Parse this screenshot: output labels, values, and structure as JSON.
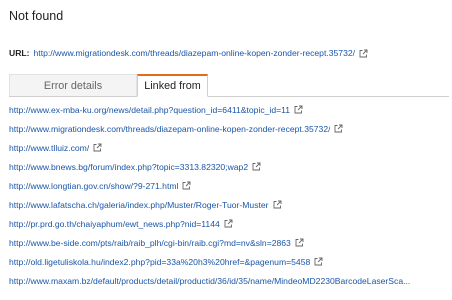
{
  "status": {
    "title": "Not found"
  },
  "url_row": {
    "label": "URL:",
    "url": "http://www.migrationdesk.com/threads/diazepam-online-kopen-zonder-recept.35732/"
  },
  "tabs": [
    {
      "label": "Error details",
      "active": false
    },
    {
      "label": "Linked from",
      "active": true
    }
  ],
  "linked_from": [
    "http://www.ex-mba-ku.org/news/detail.php?question_id=6411&topic_id=11",
    "http://www.migrationdesk.com/threads/diazepam-online-kopen-zonder-recept.35732/",
    "http://www.tlluiz.com/",
    "http://www.bnews.bg/forum/index.php?topic=3313.82320;wap2",
    "http://www.longtian.gov.cn/show/?9-271.html",
    "http://www.lafatscha.ch/galeria/index.php/Muster/Roger-Tuor-Muster",
    "http://pr.prd.go.th/chaiyaphum/ewt_news.php?nid=1144",
    "http://www.be-side.com/pts/raib/raib_plh/cgi-bin/raib.cgi?md=nv&sln=2863",
    "http://old.ligetuliskola.hu/index2.php?pid=33a%20h3%20href=&pagenum=5458",
    "http://www.maxam.bz/default/products/detail/productid/36/id/35/name/MindeoMD2230BarcodeLaserSca..."
  ],
  "icons": {
    "external_link": "external-link-icon"
  },
  "colors": {
    "link": "#1a56a8",
    "active_tab_accent": "#e36b1e"
  }
}
